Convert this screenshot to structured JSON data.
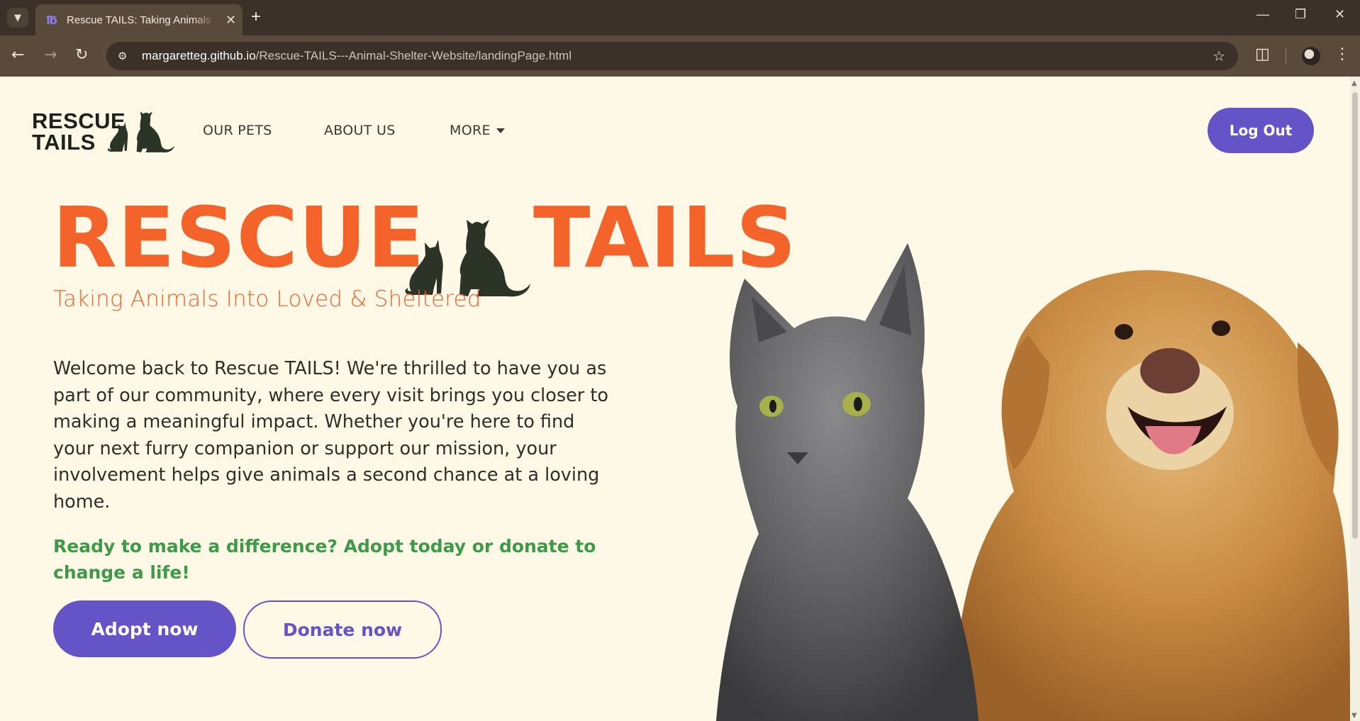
{
  "browser": {
    "tab_title": "Rescue TAILS: Taking Animals In",
    "tab_close": "✕",
    "new_tab": "+",
    "url_host": "margaretteg.github.io",
    "url_path": "/Rescue-TAILS---Animal-Shelter-Website/landingPage.html",
    "window_minimize": "—",
    "window_restore": "❐",
    "window_close": "✕"
  },
  "nav": {
    "logo_line1": "RESCUE",
    "logo_line2": "TAILS",
    "links": [
      "OUR PETS",
      "ABOUT US",
      "MORE"
    ],
    "logout_label": "Log Out"
  },
  "hero": {
    "title_left": "RESCUE",
    "title_right": "TAILS",
    "tagline": "Taking Animals Into Loved & Sheltered",
    "welcome": "Welcome back to Rescue TAILS! We're thrilled to have you as part of our community, where every visit brings you closer to making a meaningful impact. Whether you're here to find your next furry companion or support our mission, your involvement helps give animals a second chance at a loving home.",
    "cta": "Ready to make a difference? Adopt today or donate to change a life!",
    "adopt_label": "Adopt now",
    "donate_label": "Donate now"
  },
  "colors": {
    "accent_orange": "#f4632a",
    "accent_purple": "#6553c8",
    "accent_green": "#3d9a47",
    "background": "#fdf9e6"
  }
}
